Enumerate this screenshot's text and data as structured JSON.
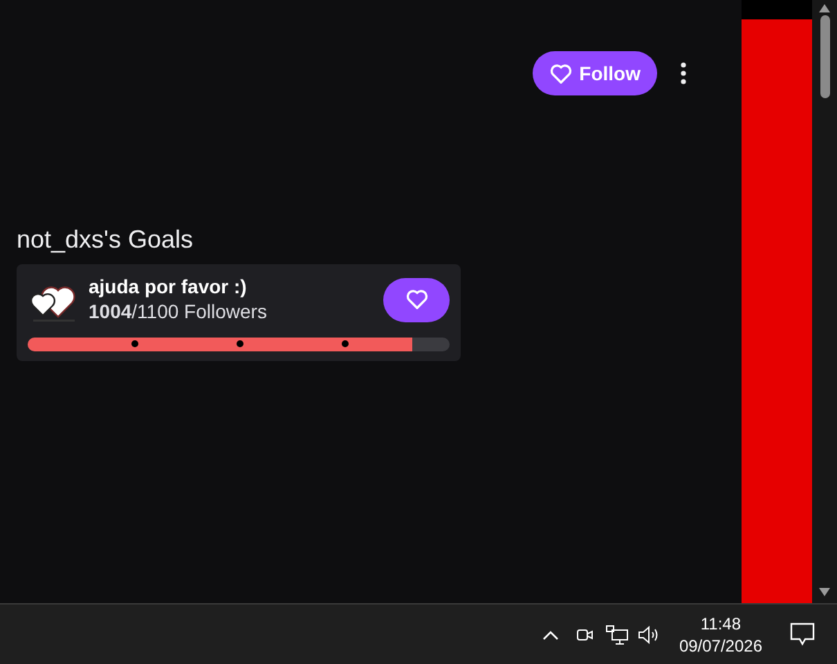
{
  "follow_button": {
    "label": "Follow"
  },
  "goals": {
    "title": "not_dxs's Goals",
    "items": [
      {
        "name": "ajuda por favor :)",
        "current": "1004",
        "target": "/1100 Followers",
        "level": 0.91
      }
    ]
  },
  "taskbar": {
    "time": "11:48",
    "date": "09/07/2026"
  }
}
